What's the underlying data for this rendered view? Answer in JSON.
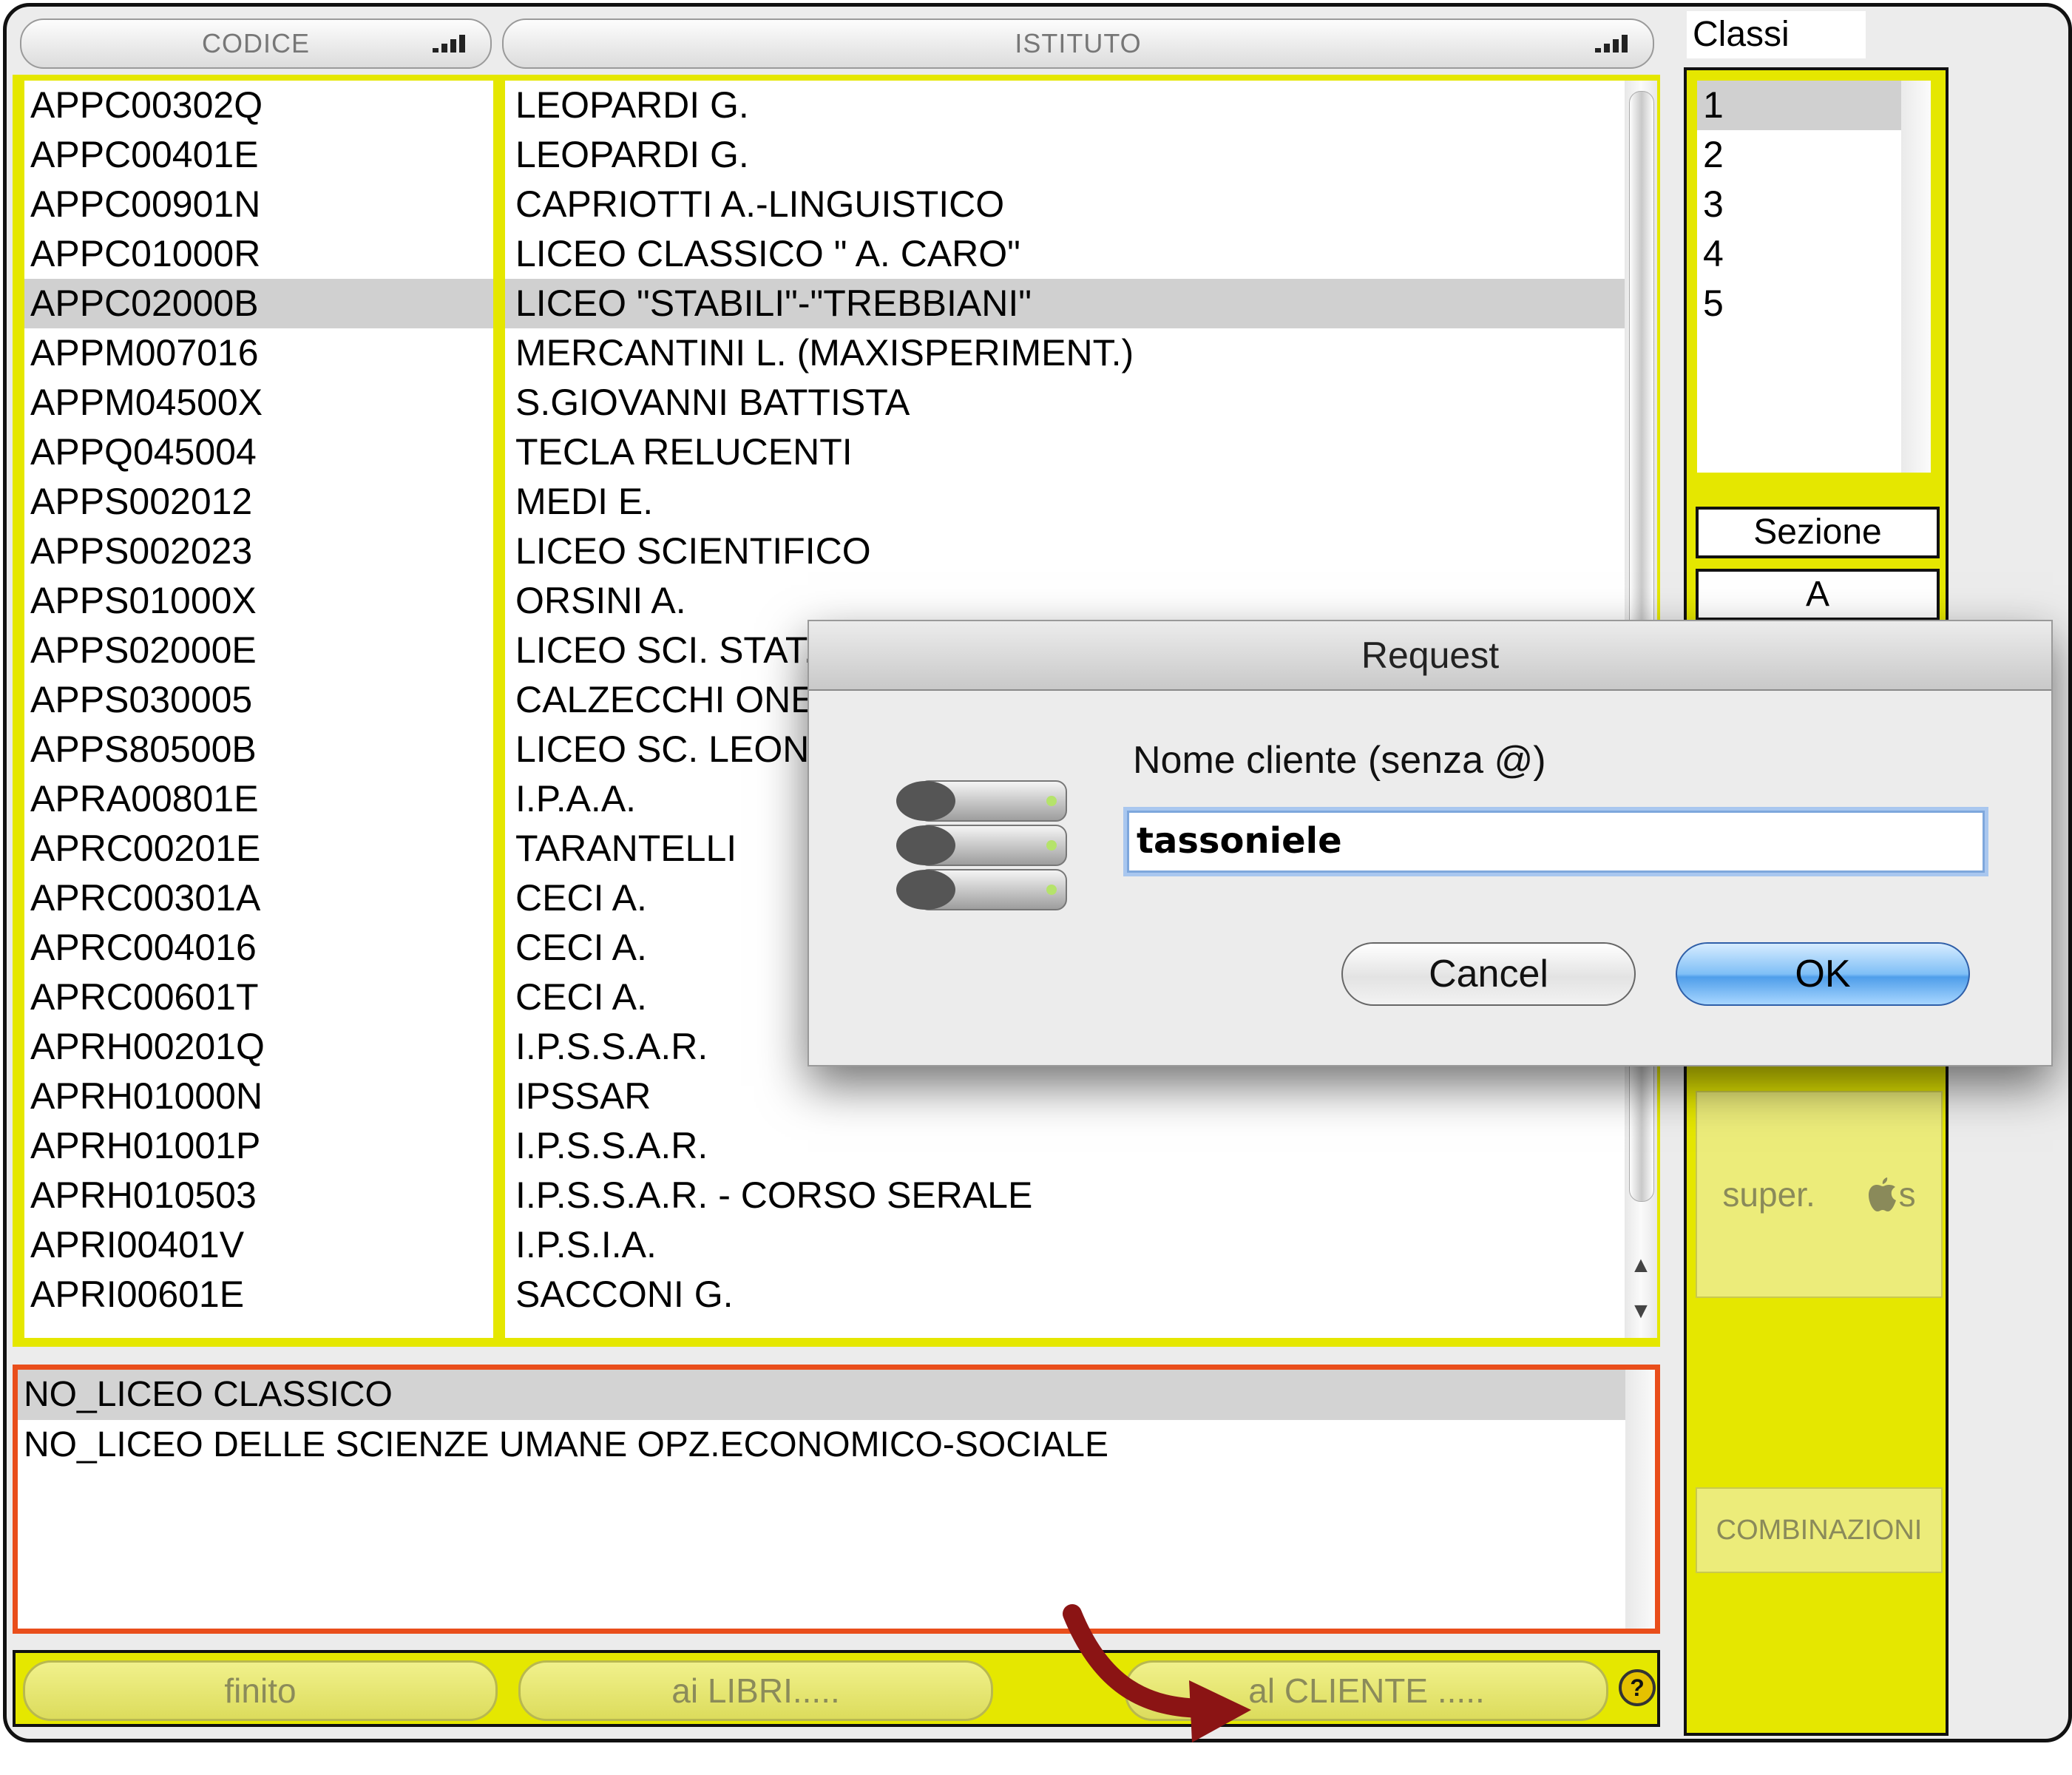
{
  "headers": {
    "codice": "CODICE",
    "istituto": "ISTITUTO"
  },
  "rows": [
    {
      "code": "APPC00302Q",
      "name": "LEOPARDI G."
    },
    {
      "code": "APPC00401E",
      "name": "LEOPARDI G."
    },
    {
      "code": "APPC00901N",
      "name": "CAPRIOTTI A.-LINGUISTICO"
    },
    {
      "code": "APPC01000R",
      "name": "LICEO CLASSICO \" A. CARO\""
    },
    {
      "code": "APPC02000B",
      "name": "LICEO \"STABILI\"-\"TREBBIANI\"",
      "selected": true
    },
    {
      "code": "APPM007016",
      "name": "MERCANTINI L. (MAXISPERIMENT.)"
    },
    {
      "code": "APPM04500X",
      "name": "S.GIOVANNI BATTISTA"
    },
    {
      "code": "APPQ045004",
      "name": "TECLA RELUCENTI"
    },
    {
      "code": "APPS002012",
      "name": "MEDI E."
    },
    {
      "code": "APPS002023",
      "name": "LICEO SCIENTIFICO"
    },
    {
      "code": "APPS01000X",
      "name": "ORSINI A."
    },
    {
      "code": "APPS02000E",
      "name": "LICEO SCI. STAT."
    },
    {
      "code": "APPS030005",
      "name": "CALZECCHI ONES"
    },
    {
      "code": "APPS80500B",
      "name": "LICEO SC. LEONA"
    },
    {
      "code": "APRA00801E",
      "name": "I.P.A.A."
    },
    {
      "code": "APRC00201E",
      "name": "TARANTELLI"
    },
    {
      "code": "APRC00301A",
      "name": "CECI A."
    },
    {
      "code": "APRC004016",
      "name": "CECI A."
    },
    {
      "code": "APRC00601T",
      "name": "CECI A."
    },
    {
      "code": "APRH00201Q",
      "name": "I.P.S.S.A.R."
    },
    {
      "code": "APRH01000N",
      "name": "IPSSAR"
    },
    {
      "code": "APRH01001P",
      "name": "I.P.S.S.A.R."
    },
    {
      "code": "APRH010503",
      "name": "I.P.S.S.A.R. - CORSO SERALE"
    },
    {
      "code": "APRI00401V",
      "name": "I.P.S.I.A."
    },
    {
      "code": "APRI00601E",
      "name": "SACCONI G."
    }
  ],
  "classi": {
    "title": "Classi",
    "items": [
      "1",
      "2",
      "3",
      "4",
      "5"
    ],
    "sezione_label": "Sezione",
    "sezione_value": "A"
  },
  "side_buttons": {
    "super_label": "super.",
    "super_suffix": "s",
    "combinazioni": "COMBINAZIONI"
  },
  "bottom_list": [
    "NO_LICEO CLASSICO",
    "NO_LICEO DELLE SCIENZE UMANE OPZ.ECONOMICO-SOCIALE"
  ],
  "bottom_bar": {
    "finito": "finito",
    "ai_libri": "ai LIBRI.....",
    "al_cliente": "al CLIENTE .....",
    "help": "?"
  },
  "dialog": {
    "title": "Request",
    "prompt": "Nome cliente (senza @)",
    "value": "tassoniele",
    "cancel": "Cancel",
    "ok": "OK"
  },
  "colors": {
    "panel_yellow": "#e5e700",
    "highlight_orange": "#e94e1b",
    "arrow_red": "#8b1414"
  }
}
